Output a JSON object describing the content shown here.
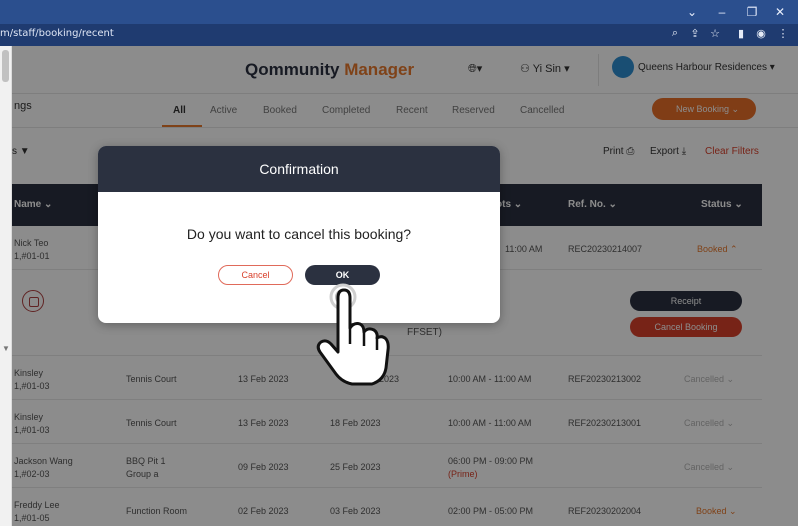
{
  "browser": {
    "url": "m/staff/booking/recent",
    "controls": [
      "⌄",
      "–",
      "❐",
      "✕"
    ]
  },
  "header": {
    "logo_part1": "Qommunity",
    "logo_part2": "Manager",
    "user_name": "Yi Sin",
    "property": "Queens Harbour Residences"
  },
  "subbar": {
    "section_title": "ngs",
    "tabs": [
      "All",
      "Active",
      "Booked",
      "Completed",
      "Recent",
      "Reserved",
      "Cancelled"
    ],
    "active_tab": "All",
    "new_booking": "New Booking"
  },
  "toolbar": {
    "filter_label": "s",
    "print": "Print",
    "export": "Export",
    "clear_filters": "Clear Filters"
  },
  "table": {
    "headers": {
      "name": "Name",
      "slots": "ots",
      "ref": "Ref. No.",
      "status": "Status"
    },
    "expanded_row": {
      "name": "Nick Teo",
      "unit": "1,#01-01",
      "time": "11:00 AM",
      "ref": "REC20230214007",
      "status": "Booked",
      "offset_text": "FFSET)",
      "receipt": "Receipt",
      "cancel_booking": "Cancel Booking"
    },
    "rows": [
      {
        "name": "Kinsley",
        "unit": "1,#01-03",
        "facility": "Tennis Court",
        "facility2": "",
        "booked_on": "13 Feb 2023",
        "date": "2023",
        "time": "10:00 AM - 11:00 AM",
        "time2": "",
        "ref": "REF20230213002",
        "status": "Cancelled"
      },
      {
        "name": "Kinsley",
        "unit": "1,#01-03",
        "facility": "Tennis Court",
        "facility2": "",
        "booked_on": "13 Feb 2023",
        "date": "18 Feb 2023",
        "time": "10:00 AM - 11:00 AM",
        "time2": "",
        "ref": "REF20230213001",
        "status": "Cancelled"
      },
      {
        "name": "Jackson Wang",
        "unit": "1,#02-03",
        "facility": "BBQ Pit 1",
        "facility2": "Group a",
        "booked_on": "09 Feb 2023",
        "date": "25 Feb 2023",
        "time": "06:00 PM - 09:00 PM",
        "time2": "(Prime)",
        "ref": "",
        "status": "Cancelled"
      },
      {
        "name": "Freddy Lee",
        "unit": "1,#01-05",
        "facility": "Function Room",
        "facility2": "",
        "booked_on": "02 Feb 2023",
        "date": "03 Feb 2023",
        "time": "02:00 PM - 05:00 PM",
        "time2": "",
        "ref": "REF20230202004",
        "status": "Booked"
      }
    ]
  },
  "modal": {
    "title": "Confirmation",
    "message": "Do you want to cancel this booking?",
    "cancel": "Cancel",
    "ok": "OK"
  }
}
